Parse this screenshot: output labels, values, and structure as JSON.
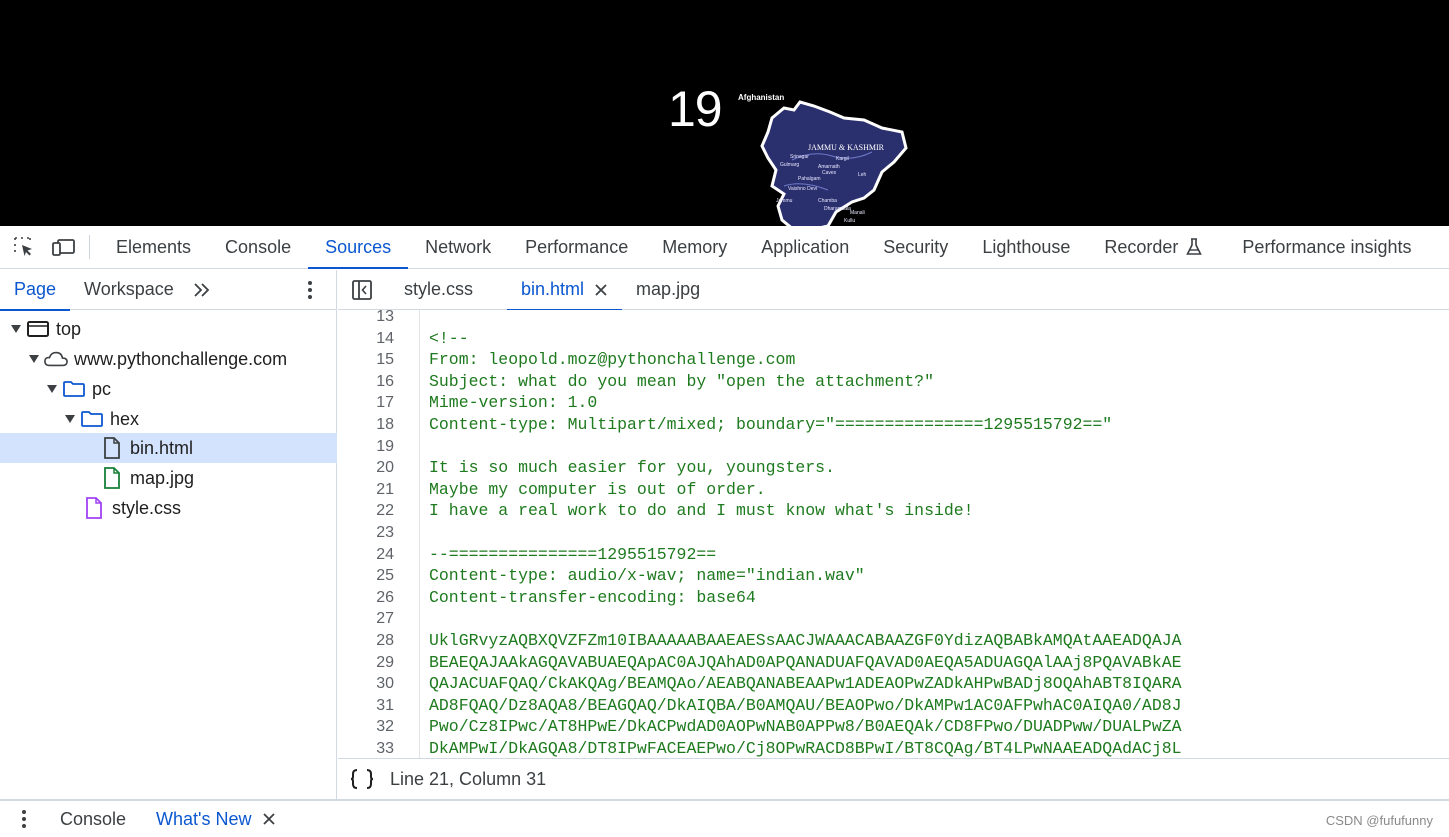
{
  "viewport": {
    "number_text": "19",
    "map_labels": {
      "country": "Afghanistan",
      "region": "JAMMU & KASHMIR",
      "places": [
        "Srinagar",
        "Kargil",
        "Amarnath",
        "Gulmarg",
        "Caves",
        "Pahalgam",
        "Leh",
        "Vaishno Devi",
        "Jammu",
        "Chamba",
        "Dharamsala",
        "Manali",
        "Kullu"
      ]
    }
  },
  "main_toolbar": {
    "tabs": [
      {
        "label": "Elements",
        "active": false
      },
      {
        "label": "Console",
        "active": false
      },
      {
        "label": "Sources",
        "active": true
      },
      {
        "label": "Network",
        "active": false
      },
      {
        "label": "Performance",
        "active": false
      },
      {
        "label": "Memory",
        "active": false
      },
      {
        "label": "Application",
        "active": false
      },
      {
        "label": "Security",
        "active": false
      },
      {
        "label": "Lighthouse",
        "active": false
      },
      {
        "label": "Recorder",
        "active": false
      },
      {
        "label": "Performance insights",
        "active": false
      }
    ]
  },
  "navigator": {
    "tabs": [
      {
        "label": "Page",
        "active": true
      },
      {
        "label": "Workspace",
        "active": false
      }
    ],
    "tree": [
      {
        "label": "top",
        "icon": "frame-icon",
        "expanded": true,
        "depth": 0,
        "selected": false
      },
      {
        "label": "www.pythonchallenge.com",
        "icon": "cloud-icon",
        "expanded": true,
        "depth": 1,
        "selected": false
      },
      {
        "label": "pc",
        "icon": "folder-icon",
        "expanded": true,
        "depth": 2,
        "selected": false
      },
      {
        "label": "hex",
        "icon": "folder-icon",
        "expanded": true,
        "depth": 3,
        "selected": false
      },
      {
        "label": "bin.html",
        "icon": "document-icon",
        "depth": 4,
        "selected": true
      },
      {
        "label": "map.jpg",
        "icon": "image-file-icon",
        "depth": 4,
        "selected": false
      },
      {
        "label": "style.css",
        "icon": "css-file-icon",
        "depth": 3,
        "selected": false
      }
    ]
  },
  "editor": {
    "tabs": [
      {
        "label": "style.css",
        "active": false,
        "closable": false
      },
      {
        "label": "bin.html",
        "active": true,
        "closable": true
      },
      {
        "label": "map.jpg",
        "active": false,
        "closable": false
      }
    ],
    "lines": [
      {
        "n": "13",
        "text": ""
      },
      {
        "n": "14",
        "text": "<!--"
      },
      {
        "n": "15",
        "text": "From: leopold.moz@pythonchallenge.com"
      },
      {
        "n": "16",
        "text": "Subject: what do you mean by \"open the attachment?\""
      },
      {
        "n": "17",
        "text": "Mime-version: 1.0"
      },
      {
        "n": "18",
        "text": "Content-type: Multipart/mixed; boundary=\"===============1295515792==\""
      },
      {
        "n": "19",
        "text": ""
      },
      {
        "n": "20",
        "text": "It is so much easier for you, youngsters."
      },
      {
        "n": "21",
        "text": "Maybe my computer is out of order."
      },
      {
        "n": "22",
        "text": "I have a real work to do and I must know what's inside!"
      },
      {
        "n": "23",
        "text": ""
      },
      {
        "n": "24",
        "text": "--===============1295515792=="
      },
      {
        "n": "25",
        "text": "Content-type: audio/x-wav; name=\"indian.wav\""
      },
      {
        "n": "26",
        "text": "Content-transfer-encoding: base64"
      },
      {
        "n": "27",
        "text": ""
      },
      {
        "n": "28",
        "text": "UklGRvyzAQBXQVZFZm10IBAAAAABAAEAESsAACJWAAACABAAZGF0YdizAQBABkAMQAtAAEADQAJA"
      },
      {
        "n": "29",
        "text": "BEAEQAJAAkAGQAVABUAEQApAC0AJQAhAD0APQANADUAFQAVAD0AEQA5ADUAGQAlAAj8PQAVABkAE"
      },
      {
        "n": "30",
        "text": "QAJACUAFQAQ/CkAKQAg/BEAMQAo/AEABQANABEAAPw1ADEAOPwZADkAHPwBADj8OQAhABT8IQARA"
      },
      {
        "n": "31",
        "text": "AD8FQAQ/Dz8AQA8/BEAGQAQ/DkAIQBA/B0AMQAU/BEAOPwo/DkAMPw1AC0AFPwhAC0AIQA0/AD8J"
      },
      {
        "n": "32",
        "text": "Pwo/Cz8IPwc/AT8HPwE/DkACPwdAD0AOPwNAB0APPw8/B0AEQAk/CD8FPwo/DUADPww/DUALPwZA"
      },
      {
        "n": "33",
        "text": "DkAMPwI/DkAGQA8/DT8IPwFACEAEPwo/Cj8OPwRACD8BPwI/BT8CQAg/BT4LPwNAAEADQAdACj8L"
      }
    ]
  },
  "status": {
    "position_text": "Line 21, Column 31"
  },
  "drawer": {
    "tabs": [
      {
        "label": "Console",
        "active": false,
        "closable": false
      },
      {
        "label": "What's New",
        "active": true,
        "closable": true
      }
    ]
  },
  "watermark": "CSDN @fufufunny",
  "colors": {
    "accent": "#0b57d0",
    "code_text": "#1e7a1e",
    "selection": "#d3e3fd",
    "border": "#d3d9e3"
  }
}
